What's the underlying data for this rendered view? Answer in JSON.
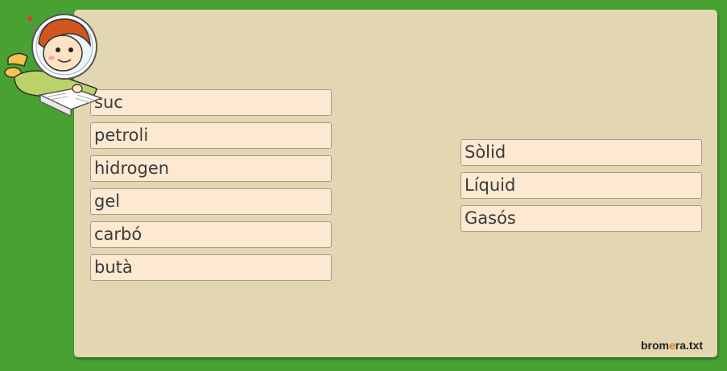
{
  "left_items": [
    "suc",
    "petroli",
    "hidrogen",
    "gel",
    "carbó",
    "butà"
  ],
  "right_items": [
    "Sòlid",
    "Líquid",
    "Gasós"
  ],
  "logo": {
    "part1": "brom",
    "part2": "e",
    "part3": "ra.txt"
  },
  "mascot_icon": "astronaut-girl-reading-book",
  "colors": {
    "background": "#47a232",
    "panel": "#e2d6b3",
    "tile": "#fde8d1"
  }
}
